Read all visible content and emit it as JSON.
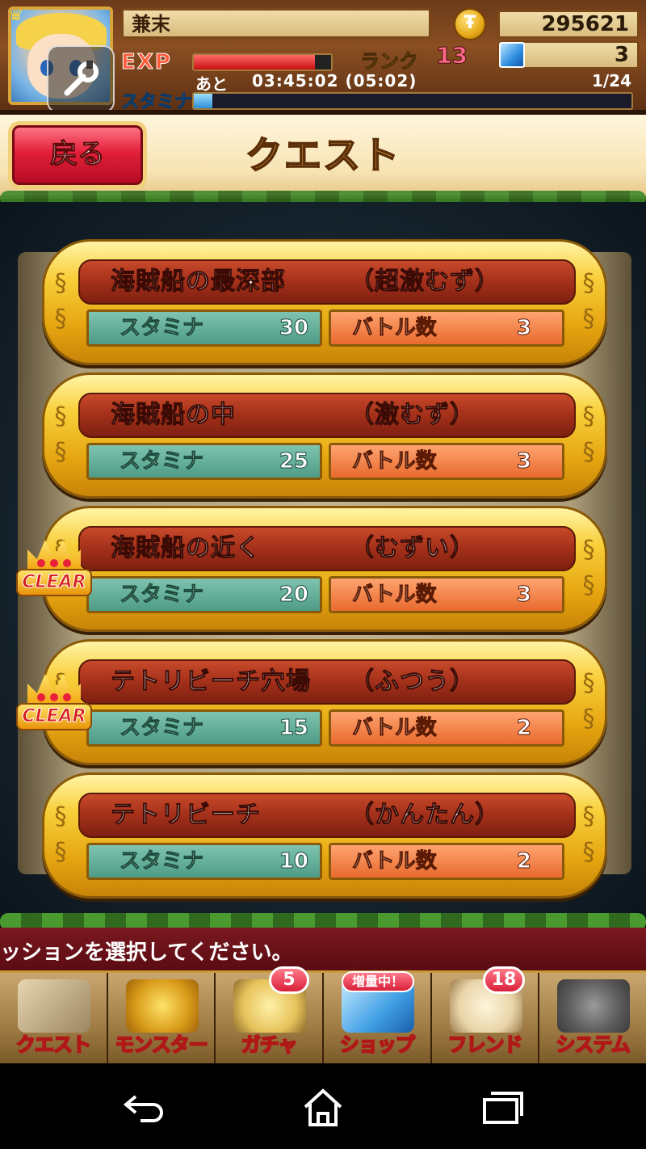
{
  "player": {
    "name": "兼末",
    "coins": "295621",
    "gems": "3",
    "exp_label": "EXP",
    "exp_progress": 0.88,
    "rank_label": "ランク",
    "rank": "13",
    "stamina_label": "スタミナ",
    "stamina_remaining_label": "あと",
    "stamina_timer": "03:45:02 (05:02)",
    "stamina_value": "1/24",
    "stamina_progress": 0.042
  },
  "header": {
    "back_label": "戻る",
    "title": "クエスト"
  },
  "quests": [
    {
      "name": "海賊船の最深部",
      "difficulty": "（超激むず）",
      "stamina_label": "スタミナ",
      "stamina": "30",
      "battle_label": "バトル数",
      "battles": "3",
      "cleared": false
    },
    {
      "name": "海賊船の中",
      "difficulty": "（激むず）",
      "stamina_label": "スタミナ",
      "stamina": "25",
      "battle_label": "バトル数",
      "battles": "3",
      "cleared": false
    },
    {
      "name": "海賊船の近く",
      "difficulty": "（むずい）",
      "stamina_label": "スタミナ",
      "stamina": "20",
      "battle_label": "バトル数",
      "battles": "3",
      "cleared": true
    },
    {
      "name": "テトリビーチ穴場",
      "difficulty": "（ふつう）",
      "stamina_label": "スタミナ",
      "stamina": "15",
      "battle_label": "バトル数",
      "battles": "2",
      "cleared": true
    },
    {
      "name": "テトリビーチ",
      "difficulty": "（かんたん）",
      "stamina_label": "スタミナ",
      "stamina": "10",
      "battle_label": "バトル数",
      "battles": "2",
      "cleared": false
    }
  ],
  "clear_label": "CLEAR",
  "message": "ッションを選択してください。",
  "nav": [
    {
      "label": "クエスト"
    },
    {
      "label": "モンスター"
    },
    {
      "label": "ガチャ",
      "badge": "5"
    },
    {
      "label": "ショップ",
      "tag": "増量中！"
    },
    {
      "label": "フレンド",
      "badge": "18"
    },
    {
      "label": "システム"
    }
  ],
  "colors": {
    "quest_gold": "#f8cf3a",
    "title_red": "#a3301a",
    "stamina_teal": "#4e9b86",
    "battle_orange": "#e86a2e",
    "nav_text_stroke": "#b01818"
  },
  "icons": {
    "tool": "wrench-icon",
    "coin": "coin-icon",
    "gem": "gem-icon",
    "back": "back-arrow-icon",
    "home": "home-icon",
    "recents": "recents-icon"
  }
}
